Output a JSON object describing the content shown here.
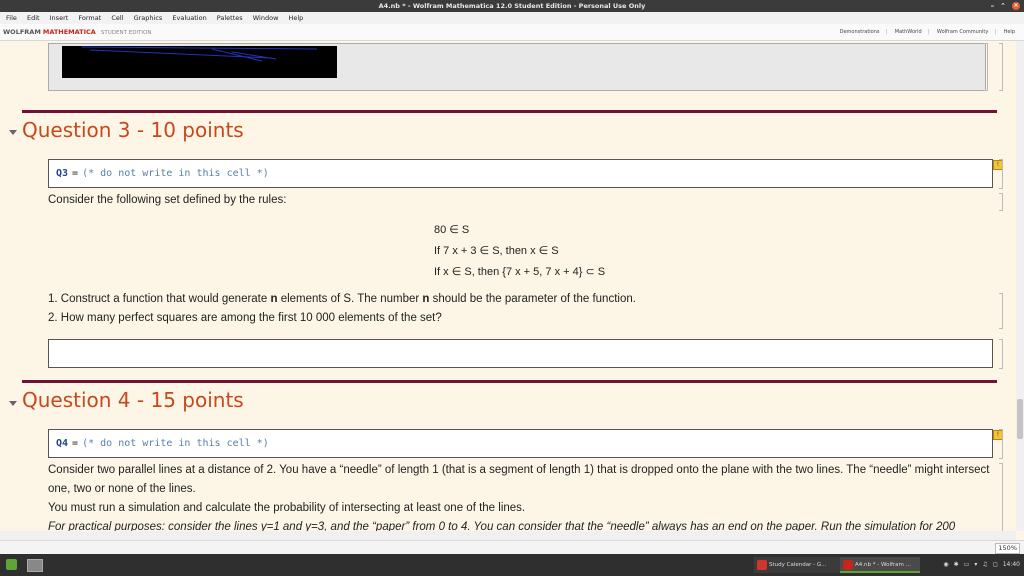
{
  "window": {
    "title": "A4.nb * - Wolfram Mathematica 12.0 Student Edition - Personal Use Only"
  },
  "menu": [
    "File",
    "Edit",
    "Insert",
    "Format",
    "Cell",
    "Graphics",
    "Evaluation",
    "Palettes",
    "Window",
    "Help"
  ],
  "brand": {
    "wolfram": "WOLFRAM",
    "mathematica": "MATHEMATICA",
    "edition": "STUDENT EDITION"
  },
  "toplinks": [
    "Demonstrations",
    "MathWorld",
    "Wolfram Community",
    "Help"
  ],
  "q3": {
    "heading": "Question 3 - 10 points",
    "input": {
      "name": "Q3",
      "eq": "=",
      "comment": "(* do not write in this cell *)"
    },
    "intro": "Consider the following set defined by the rules:",
    "rules": [
      "80 ∈ S",
      "If 7 x + 3 ∈ S,  then x ∈ S",
      "If x ∈ S,  then {7 x + 5,  7 x + 4} ⊂ S"
    ],
    "item1_pre": "1. Construct a function that would generate ",
    "item1_bold": "n",
    "item1_mid": " elements of S. The number ",
    "item1_bold2": "n",
    "item1_post": " should be the parameter of the function.",
    "item2": "2. How many perfect squares are among the first 10 000 elements of the set?"
  },
  "q4": {
    "heading": "Question 4 - 15 points",
    "input": {
      "name": "Q4",
      "eq": "=",
      "comment": "(* do not write in this cell *)"
    },
    "para1": "Consider two parallel lines at a distance of 2. You have a “needle” of length 1 (that is a segment of length 1) that is dropped onto the plane with the two lines. The “needle” might intersect one, two or none of the lines.",
    "para2": "You must run a simulation and calculate the probability of intersecting at least one of the lines.",
    "para3": "For practical purposes: consider the lines y=1 and y=3, and the “paper” from 0 to 4. You can consider that the “needle” always has an end on the paper. Run the simulation for 200"
  },
  "status": {
    "zoom": "150%"
  },
  "taskbar": {
    "tasks": [
      "Study Calendar - G...",
      "A4.nb * - Wolfram ..."
    ],
    "clock": "14:40"
  },
  "colors": {
    "section": "#c9471c",
    "rule": "#6e1237",
    "background": "#fdf6e6"
  }
}
